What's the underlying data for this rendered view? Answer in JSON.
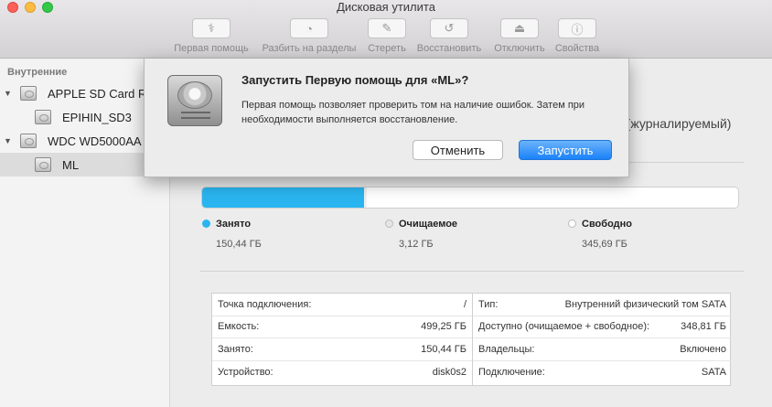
{
  "window": {
    "title": "Дисковая утилита"
  },
  "toolbar": {
    "items": [
      {
        "label": "Первая помощь",
        "icon": "stethoscope-icon",
        "glyph": "⚕"
      },
      {
        "label": "Разбить на разделы",
        "icon": "partition-icon",
        "glyph": "◔"
      },
      {
        "label": "Стереть",
        "icon": "erase-icon",
        "glyph": "✎"
      },
      {
        "label": "Восстановить",
        "icon": "restore-icon",
        "glyph": "↺"
      },
      {
        "label": "Отключить",
        "icon": "unmount-icon",
        "glyph": "⏏"
      },
      {
        "label": "Свойства",
        "icon": "info-icon",
        "glyph": "ⓘ"
      }
    ]
  },
  "sidebar": {
    "header": "Внутренние",
    "items": [
      {
        "label": "APPLE SD Card R",
        "disclosure": "▼"
      },
      {
        "label": "EPIHIN_SD3"
      },
      {
        "label": "WDC WD5000AA",
        "disclosure": "▼"
      },
      {
        "label": "ML"
      }
    ]
  },
  "main": {
    "volume_type_partial": "d (журналируемый)",
    "usage": {
      "used_fraction": 0.3017,
      "purgeable_fraction": 0.0063,
      "colors": {
        "used": "#2ab5f0",
        "purgeable": "#f0f0f0",
        "free": "#ffffff"
      },
      "legend": [
        {
          "name": "Занято",
          "value": "150,44 ГБ",
          "color": "#2ab5f0"
        },
        {
          "name": "Очищаемое",
          "value": "3,12 ГБ",
          "color": "#e5e5e5"
        },
        {
          "name": "Свободно",
          "value": "345,69 ГБ",
          "color": "#ffffff"
        }
      ]
    },
    "info_left": [
      {
        "key": "Точка подключения:",
        "value": "/"
      },
      {
        "key": "Емкость:",
        "value": "499,25 ГБ"
      },
      {
        "key": "Занято:",
        "value": "150,44 ГБ"
      },
      {
        "key": "Устройство:",
        "value": "disk0s2"
      }
    ],
    "info_right": [
      {
        "key": "Тип:",
        "value": "Внутренний физический том SATA"
      },
      {
        "key": "Доступно (очищаемое + свободное):",
        "value": "348,81 ГБ"
      },
      {
        "key": "Владельцы:",
        "value": "Включено"
      },
      {
        "key": "Подключение:",
        "value": "SATA"
      }
    ]
  },
  "dialog": {
    "title": "Запустить Первую помощь для «ML»?",
    "message": "Первая помощь позволяет проверить том на наличие ошибок. Затем при необходимости выполняется восстановление.",
    "cancel_label": "Отменить",
    "run_label": "Запустить",
    "icon": "hard-drive-icon"
  }
}
